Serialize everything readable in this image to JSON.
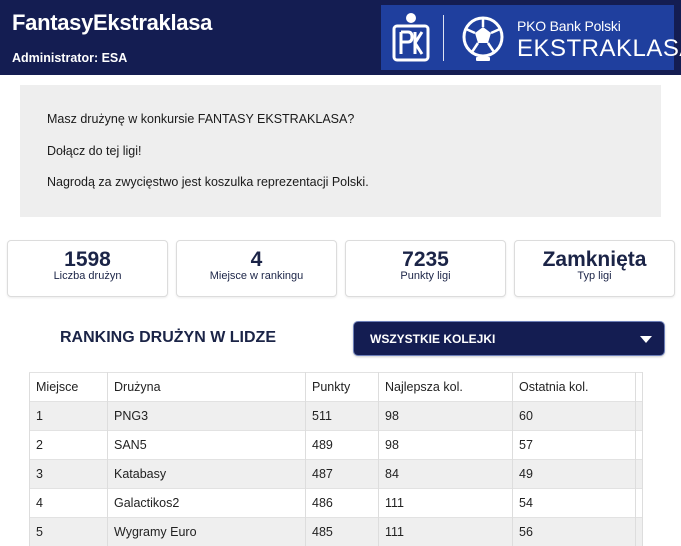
{
  "header": {
    "app_title": "FantasyEkstraklasa",
    "admin_line": "Administrator: ESA",
    "sponsor": {
      "logo_left_icon": "pko-bank-logo",
      "logo_right_icon": "ekstraklasa-ball-logo",
      "sub_text": "PKO Bank Polski",
      "main_text": "EKSTRAKLASA"
    }
  },
  "info": {
    "line1": "Masz drużynę w konkursie FANTASY EKSTRAKLASA?",
    "line2": "Dołącz do tej ligi!",
    "line3": "Nagrodą za zwycięstwo jest koszulka reprezentacji Polski."
  },
  "stats": [
    {
      "value": "1598",
      "label": "Liczba drużyn"
    },
    {
      "value": "4",
      "label": "Miejsce w rankingu"
    },
    {
      "value": "7235",
      "label": "Punkty ligi"
    },
    {
      "value": "Zamknięta",
      "label": "Typ ligi"
    }
  ],
  "ranking": {
    "title": "RANKING DRUŻYN W LIDZE",
    "filter": {
      "selected": "WSZYSTKIE KOLEJKI",
      "icon": "chevron-down-icon"
    },
    "columns": [
      "Miejsce",
      "Drużyna",
      "Punkty",
      "Najlepsza kol.",
      "Ostatnia kol."
    ],
    "rows": [
      [
        "1",
        "PNG3",
        "511",
        "98",
        "60"
      ],
      [
        "2",
        "SAN5",
        "489",
        "98",
        "57"
      ],
      [
        "3",
        "Katabasy",
        "487",
        "84",
        "49"
      ],
      [
        "4",
        "Galactikos2",
        "486",
        "111",
        "54"
      ],
      [
        "5",
        "Wygramy Euro",
        "485",
        "111",
        "56"
      ]
    ]
  },
  "colors": {
    "header_bg": "#141d52",
    "sponsor_bg": "#1f3f9e",
    "text_navy": "#1b2447",
    "info_bg": "#eeeeee"
  }
}
